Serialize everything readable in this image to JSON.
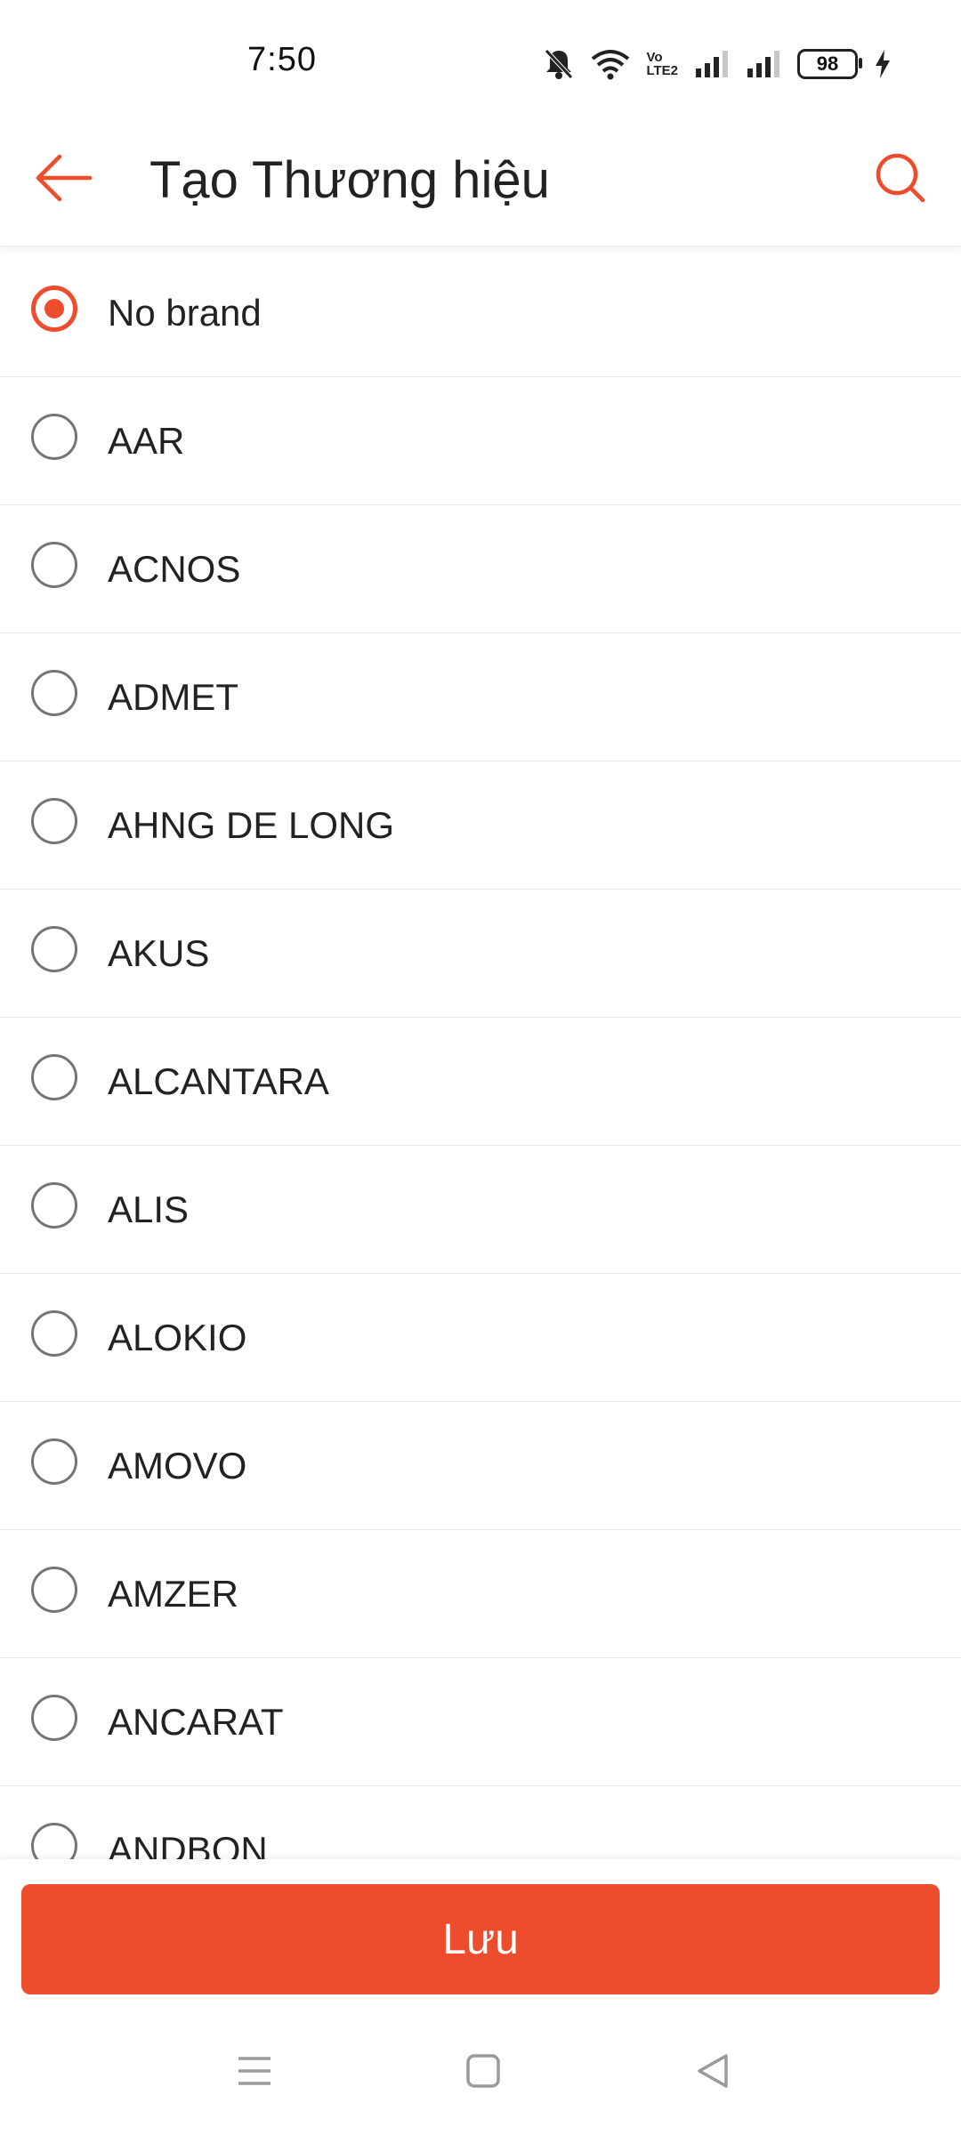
{
  "status_bar": {
    "time": "7:50",
    "battery": "98",
    "icons": [
      "bell-off-icon",
      "wifi-icon",
      "volte-icon",
      "signal-icon",
      "signal-icon",
      "battery-icon",
      "charging-icon"
    ],
    "volte_line1": "Vo",
    "volte_line2": "LTE2"
  },
  "app_bar": {
    "title": "Tạo Thương hiệu",
    "back_icon": "arrow-left-icon",
    "search_icon": "search-icon",
    "accent_color": "#ee4d2d"
  },
  "brands": {
    "selected_index": 0,
    "items": [
      {
        "label": "No brand"
      },
      {
        "label": "AAR"
      },
      {
        "label": "ACNOS"
      },
      {
        "label": "ADMET"
      },
      {
        "label": "AHNG DE LONG"
      },
      {
        "label": "AKUS"
      },
      {
        "label": "ALCANTARA"
      },
      {
        "label": "ALIS"
      },
      {
        "label": "ALOKIO"
      },
      {
        "label": "AMOVO"
      },
      {
        "label": "AMZER"
      },
      {
        "label": "ANCARAT"
      },
      {
        "label": "ANDBON"
      }
    ]
  },
  "footer": {
    "save_label": "Lưu",
    "button_color": "#ee4d2d"
  },
  "nav_bar": {
    "icons": [
      "menu-icon",
      "home-square-icon",
      "back-triangle-icon"
    ]
  }
}
